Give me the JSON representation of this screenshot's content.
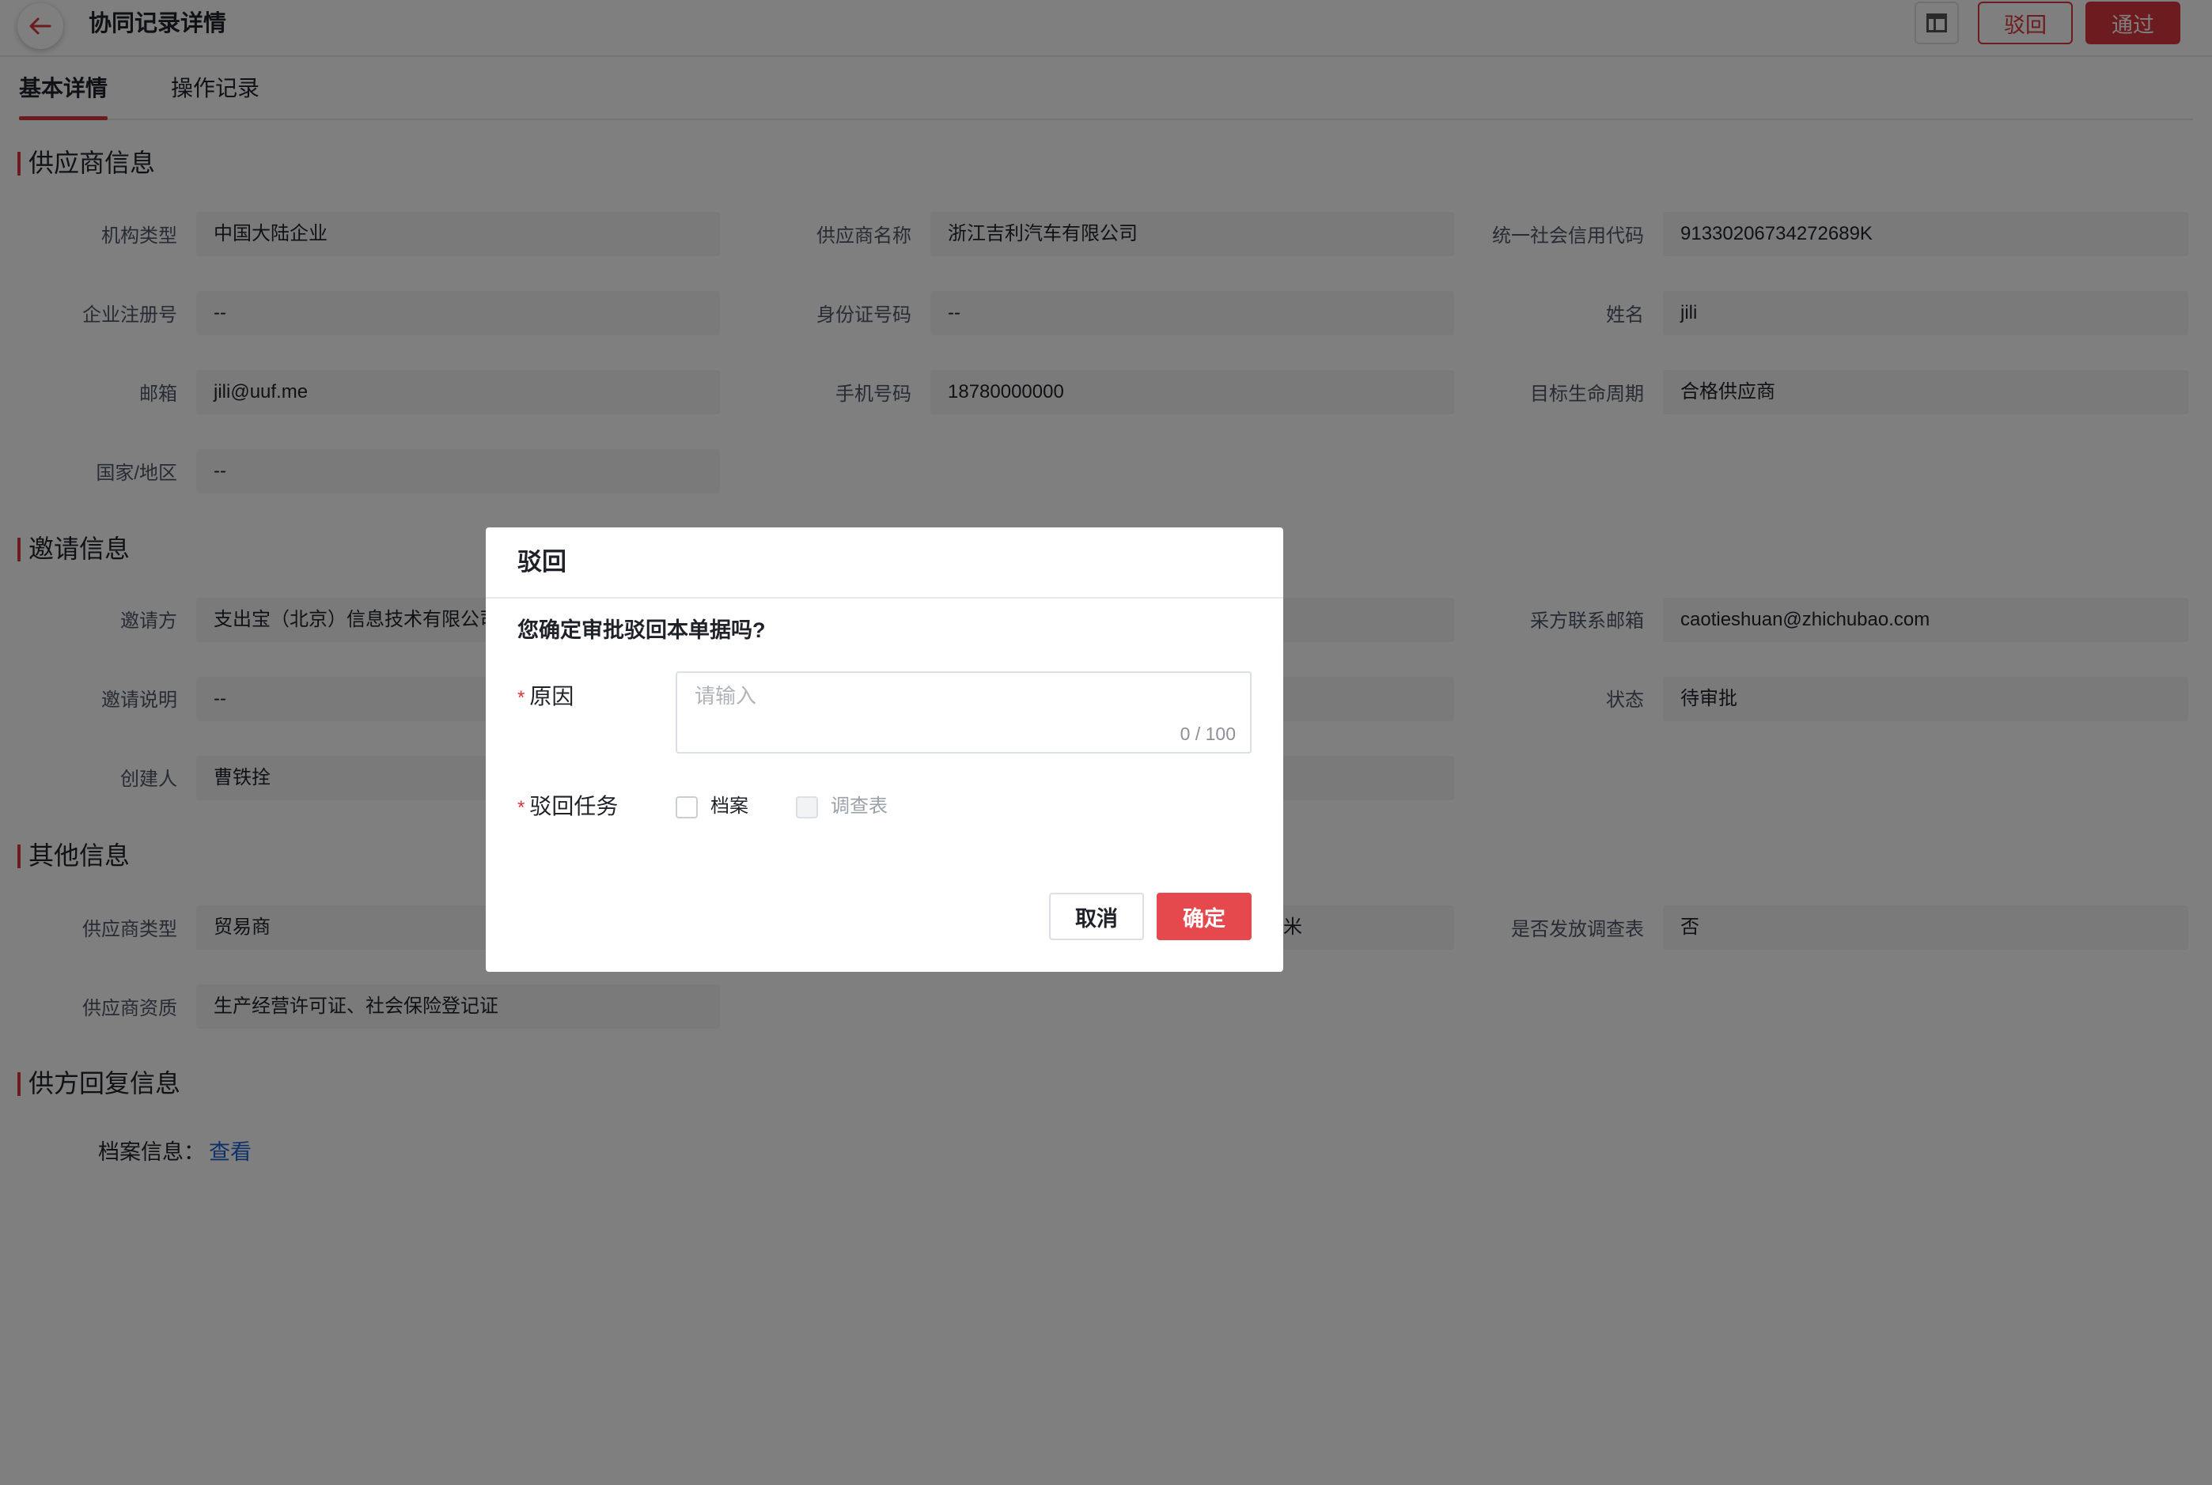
{
  "header": {
    "title": "协同记录详情",
    "reject_label": "驳回",
    "pass_label": "通过"
  },
  "tabs": [
    {
      "label": "基本详情",
      "active": true
    },
    {
      "label": "操作记录",
      "active": false
    }
  ],
  "supplier_info": {
    "title": "供应商信息",
    "fields": {
      "org_type": {
        "label": "机构类型",
        "value": "中国大陆企业"
      },
      "supplier_name": {
        "label": "供应商名称",
        "value": "浙江吉利汽车有限公司"
      },
      "credit_code": {
        "label": "统一社会信用代码",
        "value": "91330206734272689K"
      },
      "reg_no": {
        "label": "企业注册号",
        "value": "--"
      },
      "id_no": {
        "label": "身份证号码",
        "value": "--"
      },
      "name": {
        "label": "姓名",
        "value": "jili"
      },
      "email": {
        "label": "邮箱",
        "value": "jili@uuf.me"
      },
      "phone": {
        "label": "手机号码",
        "value": "18780000000"
      },
      "lifecycle": {
        "label": "目标生命周期",
        "value": "合格供应商"
      },
      "country": {
        "label": "国家/地区",
        "value": "--"
      }
    }
  },
  "invite_info": {
    "title": "邀请信息",
    "fields": {
      "inviter": {
        "label": "邀请方",
        "value": "支出宝（北京）信息技术有限公司"
      },
      "buyer_email": {
        "label": "采方联系邮箱",
        "value": "caotieshuan@zhichubao.com"
      },
      "invite_desc": {
        "label": "邀请说明",
        "value": "--"
      },
      "status": {
        "label": "状态",
        "value": "待审批"
      },
      "creator": {
        "label": "创建人",
        "value": "曹铁拴"
      }
    }
  },
  "other_info": {
    "title": "其他信息",
    "fields": {
      "supplier_type": {
        "label": "供应商类型",
        "value": "贸易商"
      },
      "middle_partial": {
        "value": "米"
      },
      "send_survey": {
        "label": "是否发放调查表",
        "value": "否"
      },
      "qualification": {
        "label": "供应商资质",
        "value": "生产经营许可证、社会保险登记证"
      }
    }
  },
  "reply_info": {
    "title": "供方回复信息",
    "archive_label": "档案信息：",
    "archive_link": "查看"
  },
  "modal": {
    "title": "驳回",
    "question": "您确定审批驳回本单据吗?",
    "required_mark": "*",
    "reason_label": "原因",
    "reason_placeholder": "请输入",
    "reason_counter": "0 / 100",
    "task_label": "驳回任务",
    "options": [
      {
        "label": "档案",
        "checked": false,
        "disabled": false
      },
      {
        "label": "调查表",
        "checked": false,
        "disabled": true
      }
    ],
    "cancel_label": "取消",
    "ok_label": "确定"
  },
  "colors": {
    "accent": "#d9363e",
    "link": "#1e63d6"
  }
}
